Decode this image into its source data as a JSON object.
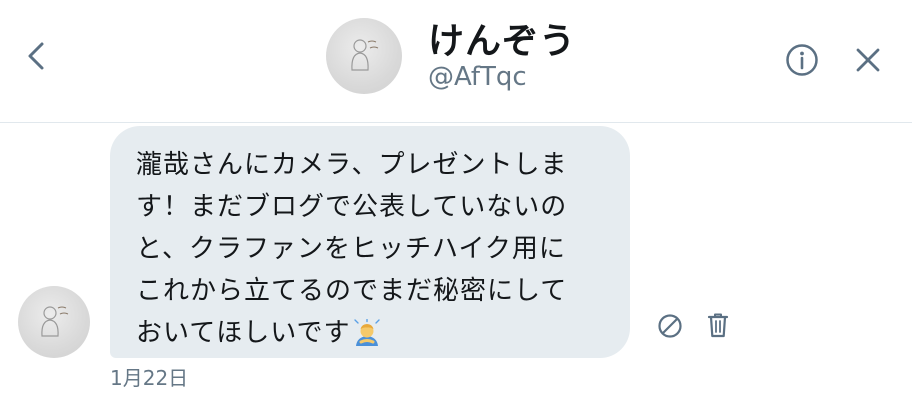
{
  "header": {
    "back_icon": "chevron-left-icon",
    "display_name": "けんぞう",
    "handle": "@AfTqc",
    "info_icon": "info-icon",
    "close_icon": "close-icon"
  },
  "message": {
    "lines": [
      "瀧哉さんにカメラ、プレゼントしま",
      "す！まだブログで公表していないの",
      "と、クラファンをヒッチハイク用に",
      "これから立てるのでまだ秘密にして",
      "おいてほしいです"
    ],
    "emoji_icon": "person-bowing-emoji",
    "timestamp": "1月22日",
    "actions": {
      "report_icon": "block-icon",
      "delete_icon": "trash-icon"
    }
  },
  "colors": {
    "bubble": "#e6ecf0",
    "muted_text": "#657786",
    "icon": "#5b7083",
    "divider": "#e1e8ed"
  }
}
